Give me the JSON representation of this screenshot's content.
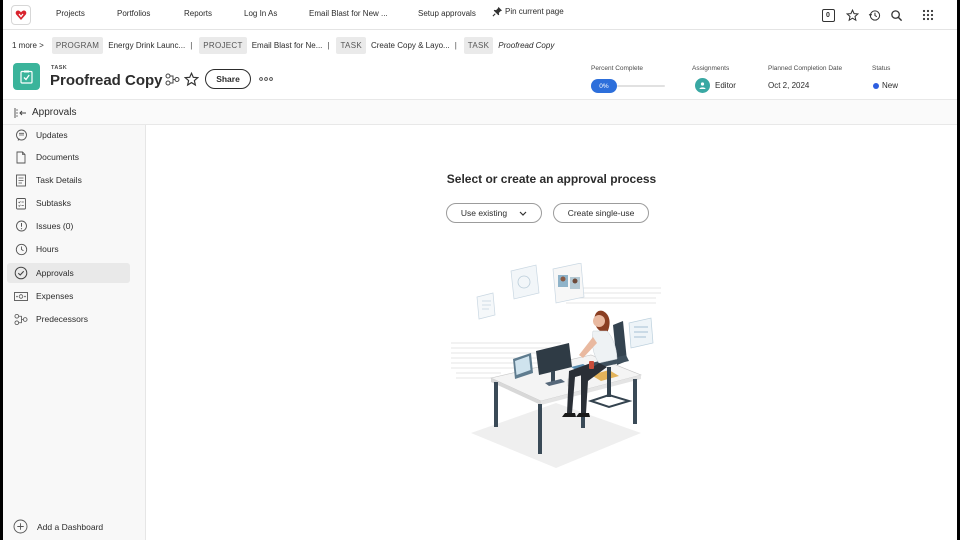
{
  "topnav": {
    "items": [
      "Projects",
      "Portfolios",
      "Reports",
      "Log In As",
      "Email Blast for New ...",
      "Setup approvals"
    ],
    "pin_label": "Pin current page",
    "notification_count": "0"
  },
  "breadcrumb": {
    "more": "1 more",
    "chevron": ">",
    "separator": "|",
    "crumbs": [
      {
        "tag": "PROGRAM",
        "text": "Energy Drink Launc..."
      },
      {
        "tag": "PROJECT",
        "text": "Email Blast for Ne..."
      },
      {
        "tag": "TASK",
        "text": "Create Copy & Layo..."
      },
      {
        "tag": "TASK",
        "text": "Proofread Copy"
      }
    ]
  },
  "header": {
    "kind": "TASK",
    "title": "Proofread Copy",
    "share_label": "Share",
    "fields": {
      "percent_label": "Percent Complete",
      "percent_value": "0%",
      "percent_fraction": 0,
      "assign_label": "Assignments",
      "assign_value": "Editor",
      "date_label": "Planned Completion Date",
      "date_value": "Oct 2, 2024",
      "status_label": "Status",
      "status_value": "New"
    }
  },
  "section": {
    "title": "Approvals"
  },
  "sidebar": {
    "items": [
      {
        "label": "Updates",
        "icon": "updates-icon"
      },
      {
        "label": "Documents",
        "icon": "documents-icon"
      },
      {
        "label": "Task Details",
        "icon": "task-details-icon"
      },
      {
        "label": "Subtasks",
        "icon": "subtasks-icon"
      },
      {
        "label": "Issues (0)",
        "icon": "issues-icon"
      },
      {
        "label": "Hours",
        "icon": "hours-icon"
      },
      {
        "label": "Approvals",
        "icon": "approvals-icon",
        "active": true
      },
      {
        "label": "Expenses",
        "icon": "expenses-icon"
      },
      {
        "label": "Predecessors",
        "icon": "predecessors-icon"
      }
    ],
    "add_dashboard": "Add a Dashboard"
  },
  "main": {
    "title": "Select or create an approval process",
    "use_existing": "Use existing",
    "create_single": "Create single-use"
  },
  "colors": {
    "task_icon": "#3bb49b",
    "percent_pill": "#2d6fdb",
    "status_dot": "#2d5ee0",
    "logo": "#d9232d"
  }
}
